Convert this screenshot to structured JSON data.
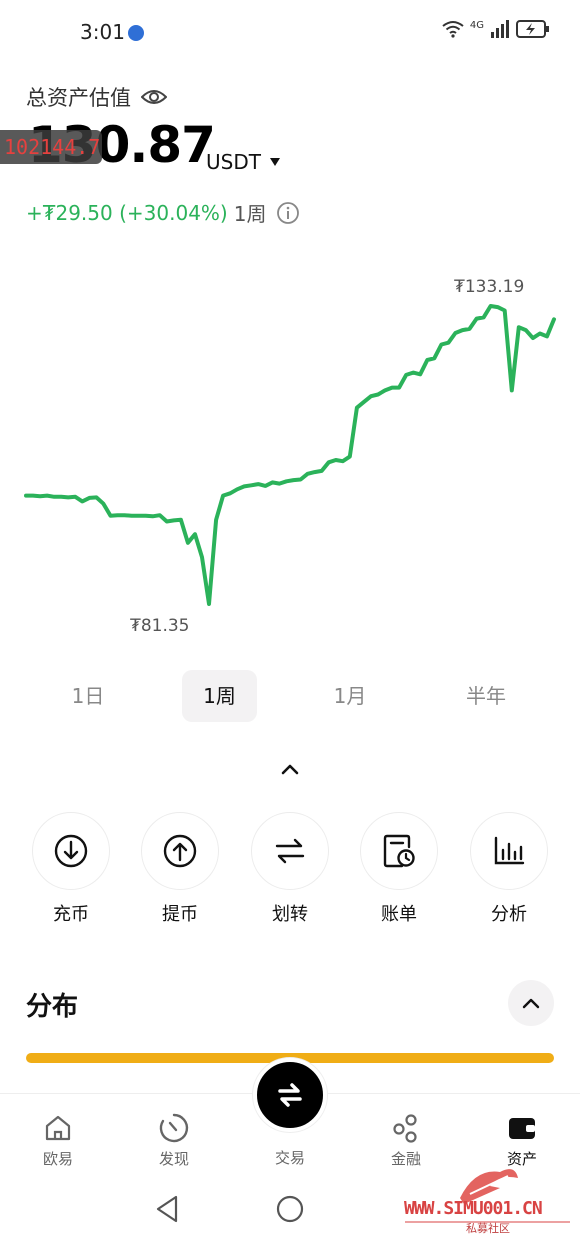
{
  "status_bar": {
    "time": "3:01",
    "network": "4G",
    "icons": [
      "globe-icon",
      "wifi-icon",
      "signal-icon",
      "battery-icon"
    ]
  },
  "header": {
    "label": "总资产估值",
    "total_value": "130.87",
    "currency": "USDT",
    "overlay_badge": "102144.7"
  },
  "change": {
    "value": "+₮29.50 (+30.04%)",
    "period": "1周"
  },
  "colors": {
    "positive": "#2bb25a",
    "accent_bar": "#f0ad16",
    "watermark": "#d84343"
  },
  "chart_data": {
    "type": "line",
    "max_label": "₮133.19",
    "min_label": "₮81.35",
    "ylim": [
      81.35,
      133.19
    ],
    "values": [
      100.2,
      100.2,
      100.1,
      100.2,
      100.0,
      100.0,
      99.9,
      100.0,
      99.2,
      99.8,
      99.9,
      98.8,
      96.7,
      96.8,
      96.8,
      96.7,
      96.7,
      96.7,
      96.6,
      96.8,
      95.7,
      95.9,
      96.0,
      92.0,
      93.5,
      89.5,
      81.35,
      96.0,
      100.2,
      100.6,
      101.3,
      101.8,
      102.0,
      102.2,
      101.9,
      102.5,
      102.3,
      102.7,
      102.9,
      103.0,
      104.0,
      104.3,
      104.5,
      106.0,
      106.4,
      106.2,
      107.0,
      115.5,
      116.5,
      117.5,
      117.8,
      118.5,
      119.0,
      119.0,
      121.2,
      121.6,
      121.3,
      123.8,
      124.1,
      126.5,
      126.8,
      128.5,
      129.0,
      129.2,
      131.0,
      131.2,
      133.19,
      133.0,
      132.4,
      118.5,
      129.5,
      129.0,
      127.6,
      128.4,
      127.9,
      130.87
    ]
  },
  "period_tabs": [
    {
      "label": "1日",
      "active": false
    },
    {
      "label": "1周",
      "active": true
    },
    {
      "label": "1月",
      "active": false
    },
    {
      "label": "半年",
      "active": false
    }
  ],
  "actions": [
    {
      "label": "充币",
      "icon": "deposit-icon"
    },
    {
      "label": "提币",
      "icon": "withdraw-icon"
    },
    {
      "label": "划转",
      "icon": "transfer-icon"
    },
    {
      "label": "账单",
      "icon": "bill-icon"
    },
    {
      "label": "分析",
      "icon": "analysis-icon"
    }
  ],
  "distribution": {
    "title": "分布"
  },
  "bottom_nav": [
    {
      "label": "欧易",
      "icon": "home-icon",
      "active": false
    },
    {
      "label": "发现",
      "icon": "discover-icon",
      "active": false
    },
    {
      "label": "交易",
      "icon": "trade-icon",
      "active": false
    },
    {
      "label": "金融",
      "icon": "finance-icon",
      "active": false
    },
    {
      "label": "资产",
      "icon": "wallet-icon",
      "active": true
    }
  ],
  "watermark": {
    "text": "WWW.SIMU001.CN",
    "sub": "私募社区"
  }
}
